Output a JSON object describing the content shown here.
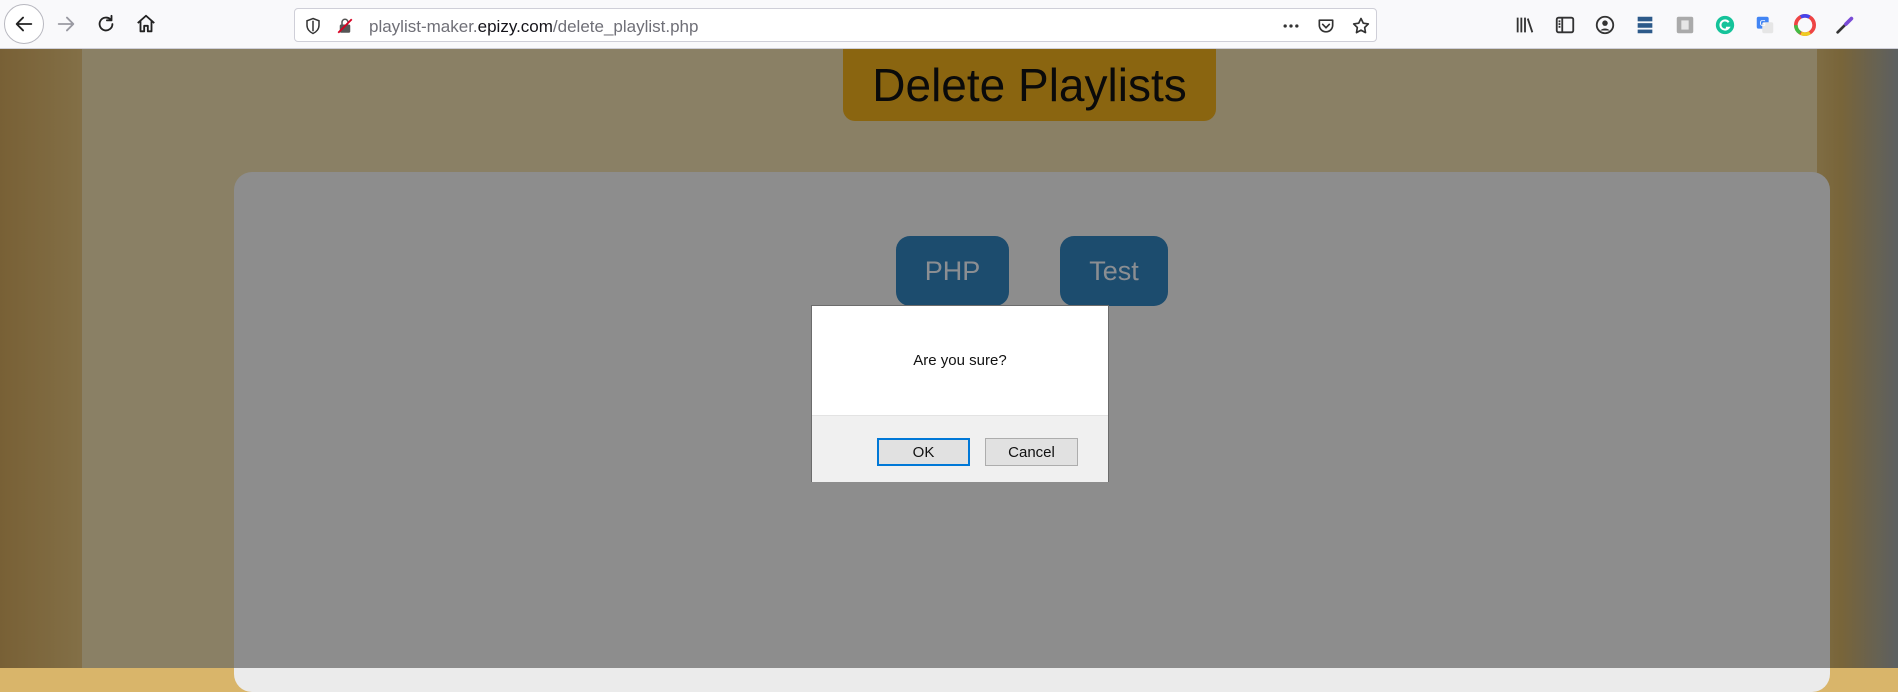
{
  "browser": {
    "url_prefix": "playlist-maker.",
    "url_domain": "epizy.com",
    "url_path": "/delete_playlist.php",
    "toolbar_icons": [
      "back-icon",
      "forward-icon",
      "reload-icon",
      "home-icon",
      "shield-icon",
      "insecure-connection-icon",
      "more-actions-icon",
      "pocket-icon",
      "bookmark-star-icon"
    ],
    "extension_icons": [
      "library-icon",
      "sidebar-icon",
      "account-icon",
      "stack-icon",
      "screenshot-icon",
      "grammarly-icon",
      "translate-icon",
      "color-wheel-icon",
      "eyedropper-icon"
    ]
  },
  "page": {
    "title": "Delete Playlists",
    "playlists": [
      {
        "label": "PHP"
      },
      {
        "label": "Test"
      }
    ]
  },
  "dialog": {
    "message": "Are you sure?",
    "ok_label": "OK",
    "cancel_label": "Cancel"
  },
  "colors": {
    "title_bg": "#e7a81b",
    "playlist_btn_bg": "#2f7fb8",
    "dialog_focus": "#0078d7"
  }
}
